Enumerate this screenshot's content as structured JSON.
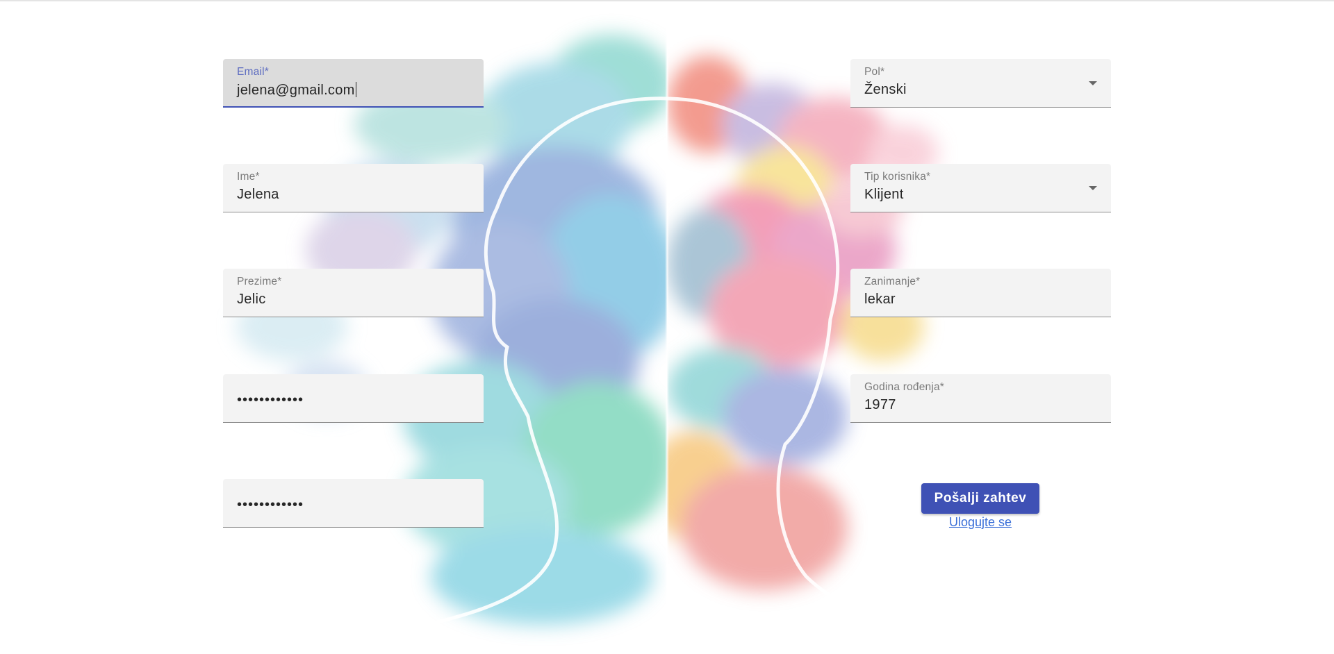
{
  "form": {
    "left_column": [
      {
        "label": "Email*",
        "value": "jelena@gmail.com",
        "focused": true
      },
      {
        "label": "Ime*",
        "value": "Jelena"
      },
      {
        "label": "Prezime*",
        "value": "Jelic"
      },
      {
        "label": "",
        "value": "••••••••••••"
      },
      {
        "label": "",
        "value": "••••••••••••"
      }
    ],
    "right_column": [
      {
        "label": "Pol*",
        "value": "Ženski",
        "type": "select"
      },
      {
        "label": "Tip korisnika*",
        "value": "Klijent",
        "type": "select"
      },
      {
        "label": "Zanimanje*",
        "value": "lekar"
      },
      {
        "label": "Godina rođenja*",
        "value": "1977"
      }
    ],
    "submit_label": "Pošalji zahtev",
    "login_link": "Ulogujte se"
  },
  "colors": {
    "accent": "#3f51b5",
    "link": "#3a6fd8",
    "field_bg": "#f3f3f3"
  }
}
